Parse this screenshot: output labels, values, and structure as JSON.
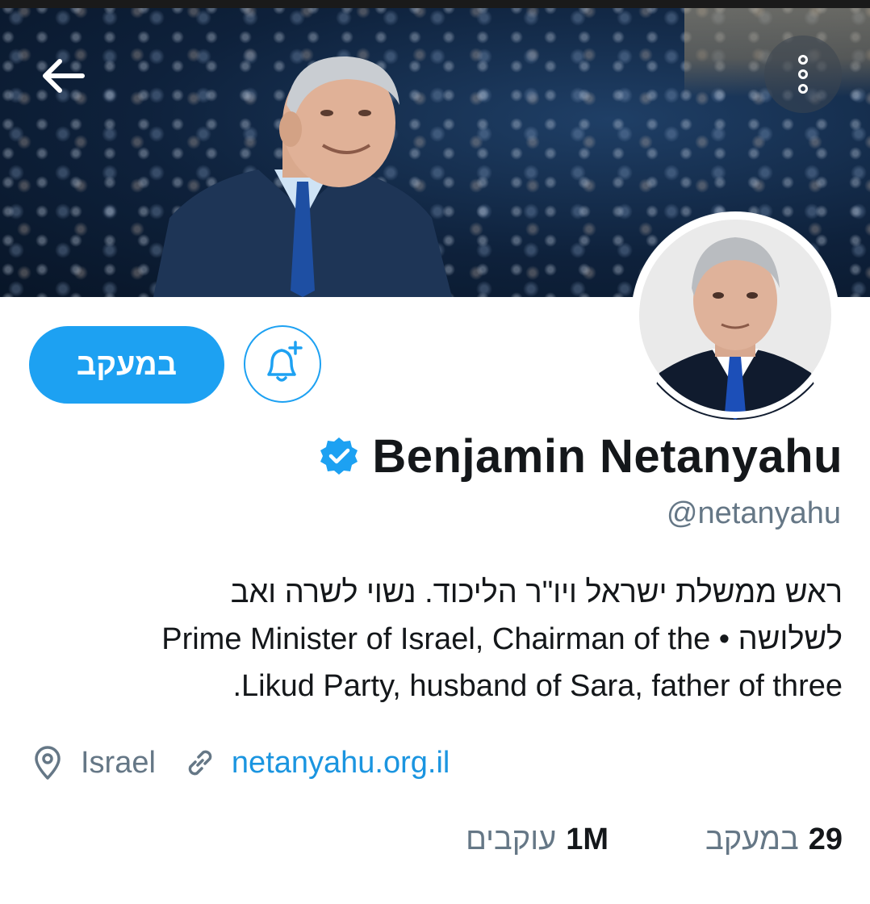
{
  "header": {
    "back_icon": "arrow-left-icon",
    "more_icon": "more-vertical-icon"
  },
  "profile": {
    "display_name": "Benjamin Netanyahu",
    "handle": "@netanyahu",
    "verified_icon": "verified-badge-icon",
    "follow_label": "במעקב",
    "notify_icon": "bell-plus-icon",
    "bio_lines": [
      "ראש ממשלת ישראל ויו\"ר הליכוד. נשוי לשרה ואב",
      "לשלושה • Prime Minister of Israel, Chairman of the",
      "Likud Party, husband of Sara, father of three."
    ],
    "location": "Israel",
    "location_icon": "location-pin-icon",
    "website": "netanyahu.org.il",
    "website_icon": "link-icon"
  },
  "stats": {
    "following_count": "29",
    "following_label": "במעקב",
    "followers_count": "1M",
    "followers_label": "עוקבים"
  },
  "colors": {
    "accent": "#1da1f2",
    "link": "#1b95e0",
    "muted": "#657786",
    "text": "#14171a"
  }
}
